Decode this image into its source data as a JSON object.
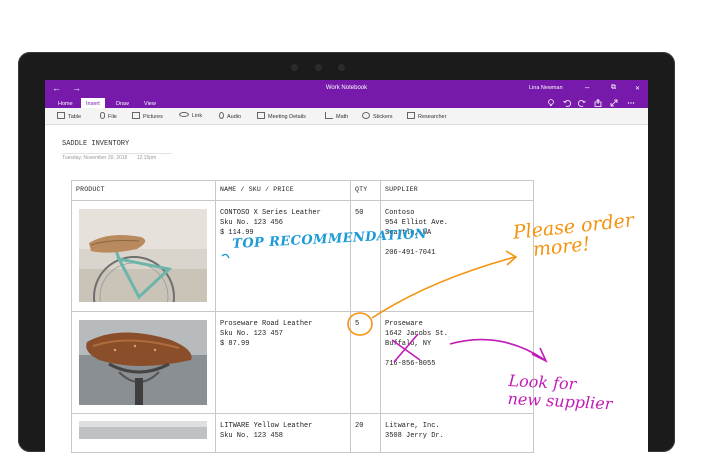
{
  "window": {
    "title": "Work Notebook",
    "user": "Lina Newman",
    "back_glyph": "←",
    "forward_glyph": "→",
    "minimize_glyph": "–",
    "restore_glyph": "⧉",
    "close_glyph": "✕"
  },
  "ribbon": {
    "tabs": [
      {
        "label": "Home"
      },
      {
        "label": "Insert",
        "active": true
      },
      {
        "label": "Draw"
      },
      {
        "label": "View"
      }
    ],
    "right_icons": [
      "bulb-icon",
      "undo-icon",
      "redo-icon",
      "share-icon",
      "expand-icon",
      "more-icon"
    ]
  },
  "toolbar": {
    "items": [
      {
        "label": "Table",
        "icon": "table-icon"
      },
      {
        "label": "File",
        "icon": "paperclip-icon"
      },
      {
        "label": "Pictures",
        "icon": "picture-icon"
      },
      {
        "label": "Link",
        "icon": "link-icon"
      },
      {
        "label": "Audio",
        "icon": "microphone-icon"
      },
      {
        "label": "Meeting Details",
        "icon": "calendar-icon"
      },
      {
        "label": "Math",
        "icon": "math-icon"
      },
      {
        "label": "Stickers",
        "icon": "sticker-icon"
      },
      {
        "label": "Researcher",
        "icon": "researcher-icon"
      }
    ]
  },
  "page": {
    "title": "SADDLE INVENTORY",
    "date": "Tuesday, November 20, 2018",
    "time": "12:15pm"
  },
  "table": {
    "headers": {
      "product": "PRODUCT",
      "name": "NAME / SKU / PRICE",
      "qty": "QTY",
      "supplier": "SUPPLIER"
    },
    "rows": [
      {
        "name_lines": "CONTOSO X Series Leather\nSku No. 123 456\n$ 114.99",
        "qty": "50",
        "supplier_lines": "Contoso\n954 Elliot Ave.\nSeattle, WA\n\n206-491-7041"
      },
      {
        "name_lines": "Proseware Road Leather\nSku No. 123 457\n$ 87.99",
        "qty": "5",
        "supplier_lines": "Proseware\n1642 Jacobs St.\nBuffalo, NY\n\n716-856-8055"
      },
      {
        "name_lines": "LITWARE Yellow Leather\nSku No. 123 458",
        "qty": "20",
        "supplier_lines": "Litware, Inc.\n3508 Jerry Dr."
      }
    ]
  },
  "ink": {
    "top_recommendation": "TOP RECOMMENDATION",
    "please_order": "Please order\n   more!",
    "look_for": "Look for\nnew supplier"
  },
  "colors": {
    "accent": "#7719aa",
    "ink_blue": "#1a9ad6",
    "ink_orange": "#f4930f",
    "ink_magenta": "#c21bb8"
  }
}
